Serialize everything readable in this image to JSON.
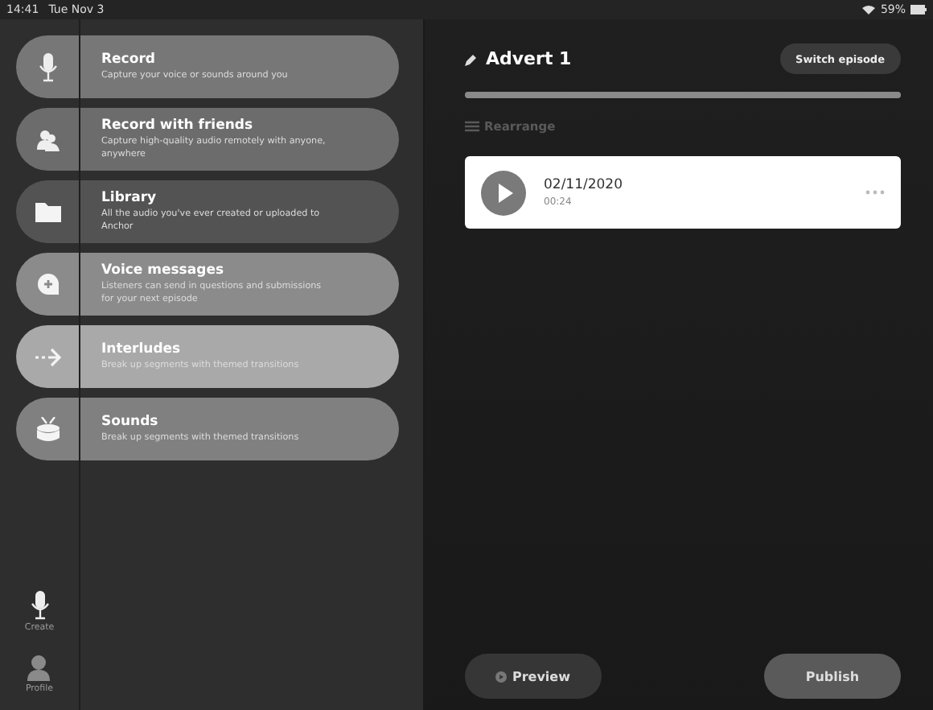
{
  "status_bar": {
    "time": "14:41",
    "date": "Tue Nov 3",
    "battery": "59%"
  },
  "menu": [
    {
      "kind": "mic",
      "title": "Record",
      "subtitle": "Capture your voice or sounds around you",
      "color": "#777777"
    },
    {
      "kind": "friends",
      "title": "Record with friends",
      "subtitle": "Capture high-quality audio remotely with anyone, anywhere",
      "color": "#6c6c6c"
    },
    {
      "kind": "folder",
      "title": "Library",
      "subtitle": "All the audio you've ever created or uploaded to Anchor",
      "color": "#535353"
    },
    {
      "kind": "bubble",
      "title": "Voice messages",
      "subtitle": "Listeners can send in questions and submissions for your next episode",
      "color": "#8b8b8b"
    },
    {
      "kind": "arrow",
      "title": "Interludes",
      "subtitle": "Break up segments with themed transitions",
      "color": "#a9a9a9"
    },
    {
      "kind": "drum",
      "title": "Sounds",
      "subtitle": "Break up segments with themed transitions",
      "color": "#808080"
    }
  ],
  "tab_bar": [
    {
      "kind": "mic",
      "label": "Create"
    },
    {
      "kind": "person",
      "label": "Profile"
    }
  ],
  "episode": {
    "title": "Advert 1",
    "switch_button": "Switch episode",
    "progress": {
      "level": 1
    },
    "rearrange": "Rearrange",
    "segments": [
      {
        "date": "02/11/2020",
        "duration": "00:24"
      }
    ],
    "preview_button": "Preview",
    "publish_button": "Publish"
  }
}
